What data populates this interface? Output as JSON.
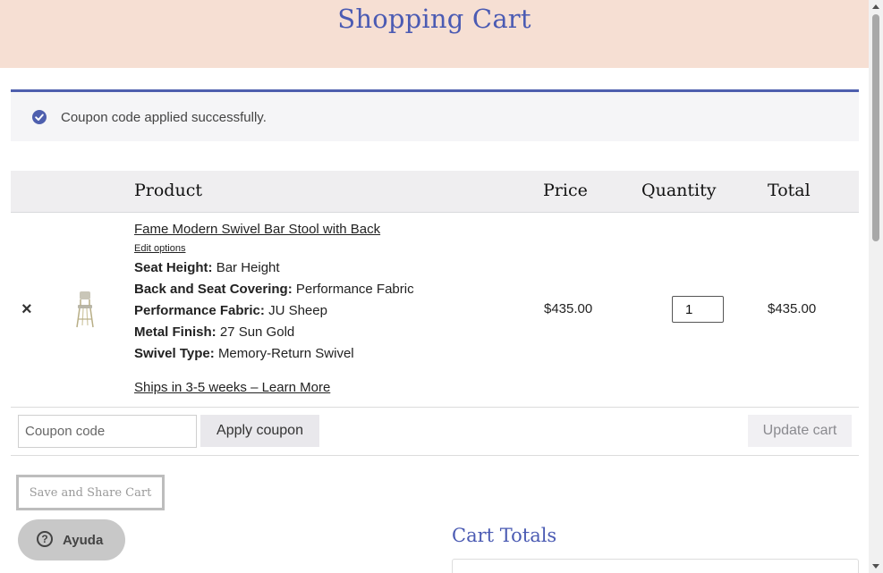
{
  "header": {
    "title": "Shopping Cart"
  },
  "notice": {
    "message": "Coupon code applied successfully."
  },
  "table": {
    "headers": {
      "product": "Product",
      "price": "Price",
      "quantity": "Quantity",
      "total": "Total"
    }
  },
  "item": {
    "remove_glyph": "×",
    "name": "Fame Modern Swivel Bar Stool with Back",
    "edit_label": "Edit options",
    "attributes": [
      {
        "label": "Seat Height:",
        "value": "Bar Height"
      },
      {
        "label": "Back and Seat Covering:",
        "value": "Performance Fabric"
      },
      {
        "label": "Performance Fabric:",
        "value": "JU Sheep"
      },
      {
        "label": "Metal Finish:",
        "value": "27 Sun Gold"
      },
      {
        "label": "Swivel Type:",
        "value": "Memory-Return Swivel"
      }
    ],
    "shipping": "Ships in 3-5 weeks – Learn More",
    "price": "$435.00",
    "quantity": "1",
    "total": "$435.00"
  },
  "actions": {
    "coupon_placeholder": "Coupon code",
    "apply_label": "Apply coupon",
    "update_label": "Update cart"
  },
  "share": {
    "label": "Save and Share Cart"
  },
  "help": {
    "label": "Ayuda",
    "icon_glyph": "?"
  },
  "totals": {
    "title": "Cart Totals"
  },
  "colors": {
    "accent": "#4b5bb3",
    "banner": "#f6dfd3",
    "notice_border": "#4e5fae"
  }
}
